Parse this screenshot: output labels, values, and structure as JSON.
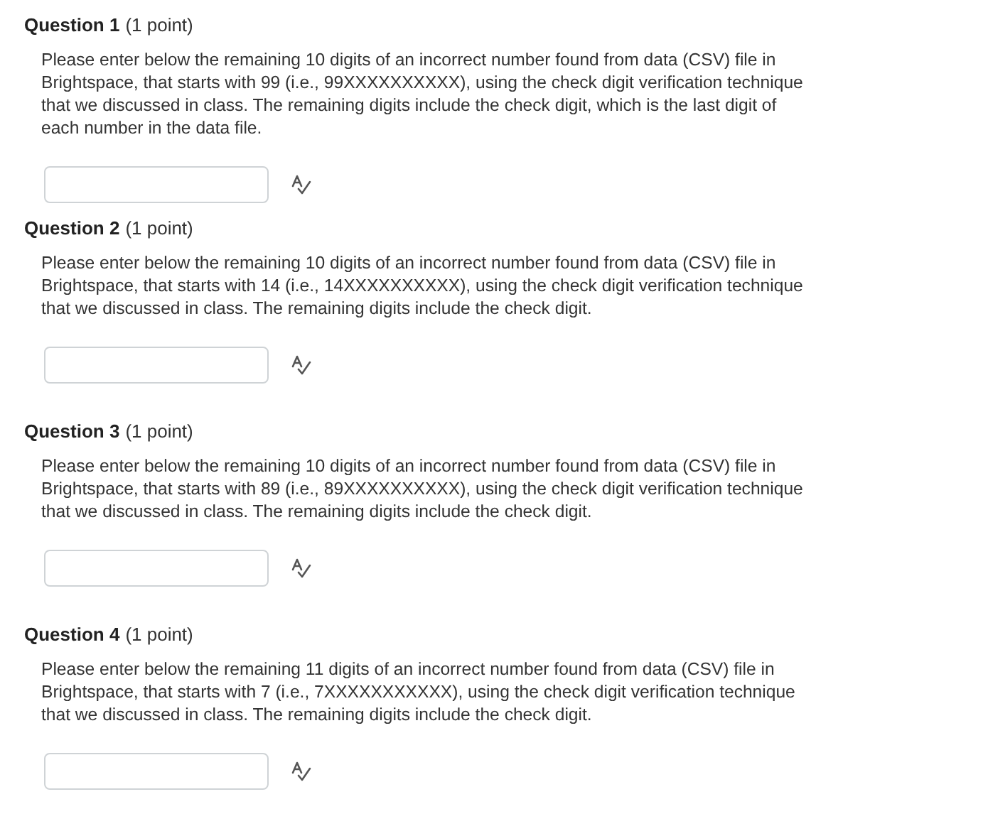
{
  "questions": [
    {
      "title": "Question 1",
      "points": "(1 point)",
      "prompt": "Please enter below the remaining 10 digits of an incorrect number found from data (CSV) file in Brightspace, that starts with 99 (i.e., 99XXXXXXXXXX), using the check digit verification technique that we discussed in class. The remaining digits include the check digit, which is the last digit of each number in the data file."
    },
    {
      "title": "Question 2",
      "points": "(1 point)",
      "prompt": "Please enter below the remaining 10 digits of an incorrect number found from data (CSV) file in Brightspace, that starts with 14 (i.e., 14XXXXXXXXXX), using the check digit verification technique that we discussed in class. The remaining digits include the check digit."
    },
    {
      "title": "Question 3",
      "points": "(1 point)",
      "prompt": "Please enter below the remaining 10 digits of an incorrect number found from data (CSV) file in Brightspace, that starts with 89 (i.e., 89XXXXXXXXXX), using the check digit verification technique that we discussed in class. The remaining digits include the check digit."
    },
    {
      "title": "Question 4",
      "points": "(1 point)",
      "prompt": "Please enter below the remaining 11 digits of an incorrect number found from data (CSV) file in Brightspace, that starts with 7 (i.e., 7XXXXXXXXXXX), using the check digit verification technique that we discussed in class. The remaining digits include the check digit."
    }
  ]
}
